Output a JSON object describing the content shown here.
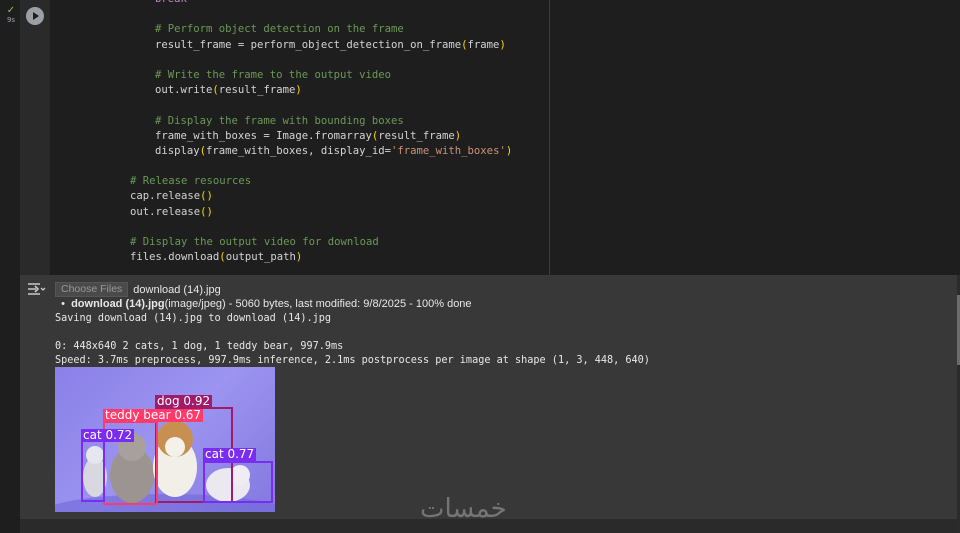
{
  "cell": {
    "status_icon": "check-icon",
    "duration": "9s",
    "code_lines": [
      {
        "indent": 3,
        "segments": [
          {
            "t": "break",
            "c": "kw"
          }
        ]
      },
      {
        "indent": 0,
        "segments": []
      },
      {
        "indent": 2,
        "segments": [
          {
            "t": "# Perform object detection on the frame",
            "c": "cmt"
          }
        ]
      },
      {
        "indent": 2,
        "segments": [
          {
            "t": "result_frame = perform_object_detection_on_frame",
            "c": ""
          },
          {
            "t": "(",
            "c": "par"
          },
          {
            "t": "frame",
            "c": ""
          },
          {
            "t": ")",
            "c": "par"
          }
        ]
      },
      {
        "indent": 0,
        "segments": []
      },
      {
        "indent": 2,
        "segments": [
          {
            "t": "# Write the frame to the output video",
            "c": "cmt"
          }
        ]
      },
      {
        "indent": 2,
        "segments": [
          {
            "t": "out.write",
            "c": ""
          },
          {
            "t": "(",
            "c": "par"
          },
          {
            "t": "result_frame",
            "c": ""
          },
          {
            "t": ")",
            "c": "par"
          }
        ]
      },
      {
        "indent": 0,
        "segments": []
      },
      {
        "indent": 2,
        "segments": [
          {
            "t": "# Display the frame with bounding boxes",
            "c": "cmt"
          }
        ]
      },
      {
        "indent": 2,
        "segments": [
          {
            "t": "frame_with_boxes = Image.fromarray",
            "c": ""
          },
          {
            "t": "(",
            "c": "par"
          },
          {
            "t": "result_frame",
            "c": ""
          },
          {
            "t": ")",
            "c": "par"
          }
        ]
      },
      {
        "indent": 2,
        "segments": [
          {
            "t": "display",
            "c": ""
          },
          {
            "t": "(",
            "c": "par"
          },
          {
            "t": "frame_with_boxes, display_id=",
            "c": ""
          },
          {
            "t": "'frame_with_boxes'",
            "c": "str"
          },
          {
            "t": ")",
            "c": "par"
          }
        ]
      },
      {
        "indent": 0,
        "segments": []
      },
      {
        "indent": 1,
        "segments": [
          {
            "t": "# Release resources",
            "c": "cmt"
          }
        ]
      },
      {
        "indent": 1,
        "segments": [
          {
            "t": "cap.release",
            "c": ""
          },
          {
            "t": "()",
            "c": "par"
          }
        ]
      },
      {
        "indent": 1,
        "segments": [
          {
            "t": "out.release",
            "c": ""
          },
          {
            "t": "()",
            "c": "par"
          }
        ]
      },
      {
        "indent": 0,
        "segments": []
      },
      {
        "indent": 1,
        "segments": [
          {
            "t": "# Display the output video for download",
            "c": "cmt"
          }
        ]
      },
      {
        "indent": 1,
        "segments": [
          {
            "t": "files.download",
            "c": ""
          },
          {
            "t": "(",
            "c": "par"
          },
          {
            "t": "output_path",
            "c": ""
          },
          {
            "t": ")",
            "c": "par"
          }
        ]
      }
    ]
  },
  "output": {
    "output_icon": "output-toggle-icon",
    "choose_files_label": "Choose Files",
    "chosen_file": "download (14).jpg",
    "file_info_name": "download (14).jpg",
    "file_info_rest": "(image/jpeg) - 5060 bytes, last modified: 9/8/2025 - 100% done",
    "saving_line": "Saving download (14).jpg to download (14).jpg",
    "detect_line": "0: 448x640 2 cats, 1 dog, 1 teddy bear, 997.9ms",
    "speed_line": "Speed: 3.7ms preprocess, 997.9ms inference, 2.1ms postprocess per image at shape (1, 3, 448, 640)",
    "detections": [
      {
        "label": "dog 0.92",
        "color": "#a01c6b"
      },
      {
        "label": "teddy bear 0.67",
        "color": "#ff3b6b"
      },
      {
        "label": "cat 0.72",
        "color": "#7a2cf0"
      },
      {
        "label": "cat 0.77",
        "color": "#7a2cf0"
      }
    ]
  },
  "watermark": "خمسات"
}
